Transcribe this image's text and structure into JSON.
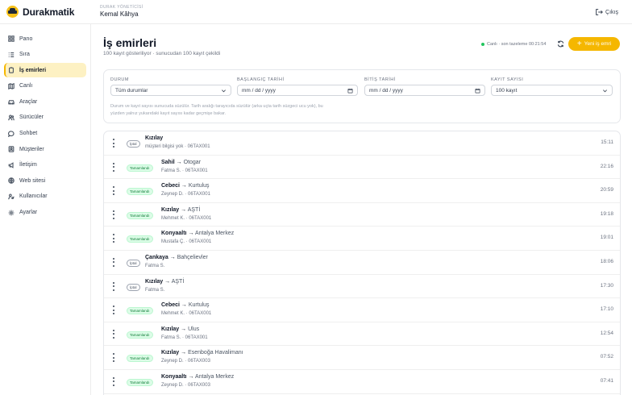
{
  "header": {
    "brand": "Durakmatik",
    "role_label": "DURAK YÖNETİCİSİ",
    "user_name": "Kemal Kâhya",
    "logout_label": "Çıkış"
  },
  "sidebar": {
    "items": [
      {
        "label": "Pano",
        "icon": "grid-icon"
      },
      {
        "label": "Sıra",
        "icon": "list-icon"
      },
      {
        "label": "İş emirleri",
        "icon": "clipboard-icon",
        "active": true
      },
      {
        "label": "Canlı",
        "icon": "map-icon"
      },
      {
        "label": "Araçlar",
        "icon": "car-icon"
      },
      {
        "label": "Sürücüler",
        "icon": "users-icon"
      },
      {
        "label": "Sohbet",
        "icon": "chat-icon"
      },
      {
        "label": "Müşteriler",
        "icon": "contacts-icon"
      },
      {
        "label": "İletişim",
        "icon": "megaphone-icon"
      },
      {
        "label": "Web sitesi",
        "icon": "globe-icon"
      },
      {
        "label": "Kullanıcılar",
        "icon": "user-key-icon"
      },
      {
        "label": "Ayarlar",
        "icon": "gear-icon"
      }
    ]
  },
  "main": {
    "title": "İş emirleri",
    "subtitle": "100 kayıt gösteriliyor · sunucudan 100 kayıt çekildi",
    "live_status": "Canlı · son tazeleme 00:21:54",
    "new_button_label": "Yeni iş emri",
    "accent_color": "#f5b700"
  },
  "filters": {
    "status": {
      "label": "DURUM",
      "value": "Tüm durumlar"
    },
    "start_date": {
      "label": "BAŞLANGIÇ TARİHİ",
      "value": "mm / dd / yyyy"
    },
    "end_date": {
      "label": "BİTİŞ TARİHİ",
      "value": "mm / dd / yyyy"
    },
    "record_count": {
      "label": "KAYIT SAYISI",
      "value": "100 kayıt"
    },
    "hint": "Durum ve kayıt sayısı sunucuda süzülür. Tarih aralığı tarayıcıda süzülür (arka uçta tarih süzgeci ucu yok), bu yüzden yalnız yukarıdaki kayıt sayısı kadar geçmişe bakar."
  },
  "orders": [
    {
      "status": "İptal",
      "status_type": "cancel",
      "from": "Kızılay",
      "to": "",
      "sub": "müşteri bilgisi yok · 06TAX001",
      "time": "15:11"
    },
    {
      "status": "Tamamlandı",
      "status_type": "done",
      "from": "Sahil",
      "to": "Otogar",
      "sub": "Fatma S. · 06TAX001",
      "time": "22:16"
    },
    {
      "status": "Tamamlandı",
      "status_type": "done",
      "from": "Cebeci",
      "to": "Kurtuluş",
      "sub": "Zeynep D. · 06TAX001",
      "time": "20:59"
    },
    {
      "status": "Tamamlandı",
      "status_type": "done",
      "from": "Kızılay",
      "to": "AŞTİ",
      "sub": "Mehmet K. · 06TAX001",
      "time": "19:18"
    },
    {
      "status": "Tamamlandı",
      "status_type": "done",
      "from": "Konyaaltı",
      "to": "Antalya Merkez",
      "sub": "Mustafa Ç. · 06TAX001",
      "time": "19:01"
    },
    {
      "status": "İptal",
      "status_type": "cancel",
      "from": "Çankaya",
      "to": "Bahçelievler",
      "sub": "Fatma S.",
      "time": "18:06"
    },
    {
      "status": "İptal",
      "status_type": "cancel",
      "from": "Kızılay",
      "to": "AŞTİ",
      "sub": "Fatma S.",
      "time": "17:30"
    },
    {
      "status": "Tamamlandı",
      "status_type": "done",
      "from": "Cebeci",
      "to": "Kurtuluş",
      "sub": "Mehmet K. · 06TAX001",
      "time": "17:10"
    },
    {
      "status": "Tamamlandı",
      "status_type": "done",
      "from": "Kızılay",
      "to": "Ulus",
      "sub": "Fatma S. · 06TAX001",
      "time": "12:54"
    },
    {
      "status": "Tamamlandı",
      "status_type": "done",
      "from": "Kızılay",
      "to": "Esenboğa Havalimanı",
      "sub": "Zeynep D. · 06TAX003",
      "time": "07:52"
    },
    {
      "status": "Tamamlandı",
      "status_type": "done",
      "from": "Konyaaltı",
      "to": "Antalya Merkez",
      "sub": "Zeynep D. · 06TAX003",
      "time": "07:41"
    }
  ]
}
